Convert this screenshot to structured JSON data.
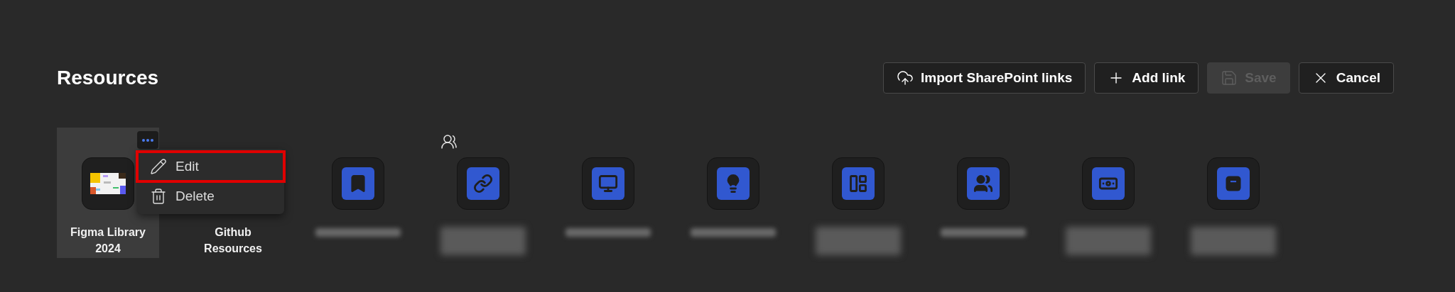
{
  "header": {
    "title": "Resources"
  },
  "actions": [
    {
      "kind": "import",
      "label": "Import SharePoint links",
      "disabled": false
    },
    {
      "kind": "add",
      "label": "Add link",
      "disabled": false
    },
    {
      "kind": "save",
      "label": "Save",
      "disabled": true
    },
    {
      "kind": "cancel",
      "label": "Cancel",
      "disabled": false
    }
  ],
  "tiles": [
    {
      "kind": "picture",
      "label": "Figma Library 2024",
      "selected": true,
      "shared": false
    },
    {
      "kind": "none",
      "label": "Github Resources",
      "selected": false,
      "shared": false
    },
    {
      "kind": "bookmark",
      "blurred": true,
      "wrapped": false,
      "selected": false,
      "shared": false
    },
    {
      "kind": "link",
      "blurred": true,
      "wrapped": true,
      "selected": false,
      "shared": true
    },
    {
      "kind": "monitor",
      "blurred": true,
      "wrapped": false,
      "selected": false,
      "shared": false
    },
    {
      "kind": "lightbulb",
      "blurred": true,
      "wrapped": false,
      "selected": false,
      "shared": false
    },
    {
      "kind": "layout",
      "blurred": true,
      "wrapped": true,
      "selected": false,
      "shared": false
    },
    {
      "kind": "people",
      "blurred": true,
      "wrapped": false,
      "selected": false,
      "shared": false
    },
    {
      "kind": "money",
      "blurred": true,
      "wrapped": true,
      "selected": false,
      "shared": false
    },
    {
      "kind": "box",
      "blurred": true,
      "wrapped": true,
      "selected": false,
      "shared": false
    }
  ],
  "menu": {
    "items": [
      {
        "kind": "edit",
        "label": "Edit",
        "highlighted": true
      },
      {
        "kind": "delete",
        "label": "Delete",
        "highlighted": false
      }
    ]
  }
}
